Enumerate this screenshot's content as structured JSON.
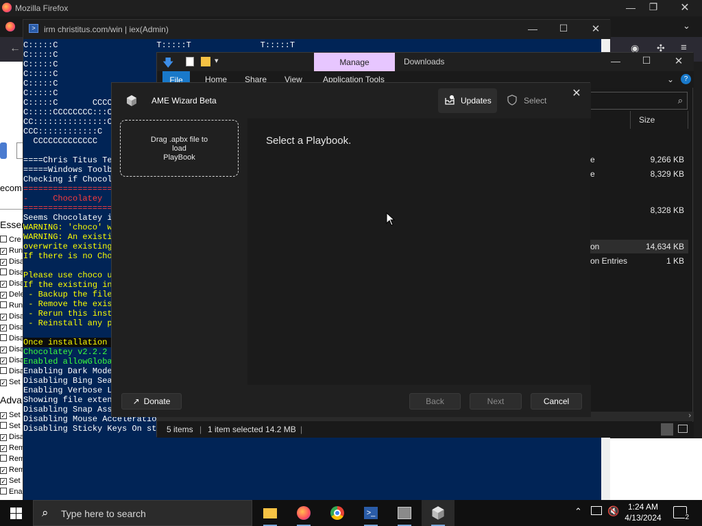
{
  "firefox": {
    "title": "Mozilla Firefox",
    "left_text": "ecom",
    "sections": [
      "Essen",
      "Adva"
    ],
    "checkbox_labels": [
      "Cre",
      "Run",
      "Disa",
      "Disa",
      "Disa",
      "Dele",
      "Run",
      "Disa",
      "Disa",
      "Disa",
      "Disa",
      "Disa",
      "Disa",
      "Set",
      "Set",
      "Set",
      "Disa",
      "Rem",
      "Rem",
      "Rem",
      "Set",
      "Ena"
    ]
  },
  "powershell": {
    "title": "irm christitus.com/win | iex(Admin)",
    "lines": [
      {
        "text": "C:::::C                    T:::::T              T:::::T",
        "color": "white"
      },
      {
        "text": "C:::::C",
        "color": "white"
      },
      {
        "text": "C:::::C",
        "color": "white"
      },
      {
        "text": "C:::::C",
        "color": "white"
      },
      {
        "text": "C:::::C",
        "color": "white"
      },
      {
        "text": "C:::::C",
        "color": "white"
      },
      {
        "text": "C:::::C       CCCC",
        "color": "white"
      },
      {
        "text": "C:::::CCCCCCCC:::C",
        "color": "white"
      },
      {
        "text": "CC:::::::::::::::C",
        "color": "white"
      },
      {
        "text": "CCC::::::::::::C",
        "color": "white"
      },
      {
        "text": "  CCCCCCCCCCCCC",
        "color": "white"
      },
      {
        "text": "",
        "color": "white"
      },
      {
        "text": "====Chris Titus Tec",
        "color": "white"
      },
      {
        "text": "=====Windows Toolbo",
        "color": "white"
      },
      {
        "text": "Checking if Chocola",
        "color": "white"
      },
      {
        "text": "===================",
        "color": "red"
      },
      {
        "text": "-     Chocolatey",
        "color": "red"
      },
      {
        "text": "===================",
        "color": "red"
      },
      {
        "text": "Seems Chocolatey is",
        "color": "white"
      },
      {
        "text": "WARNING: 'choco' wa",
        "color": "yellow"
      },
      {
        "text": "WARNING: An existin",
        "color": "yellow"
      },
      {
        "text": "overwrite existing",
        "color": "yellow"
      },
      {
        "text": "If there is no Choc",
        "color": "yellow"
      },
      {
        "text": "",
        "color": "white"
      },
      {
        "text": "Please use choco up",
        "color": "yellow"
      },
      {
        "text": "If the existing ins",
        "color": "yellow"
      },
      {
        "text": " - Backup the files",
        "color": "yellow"
      },
      {
        "text": " - Remove the exist",
        "color": "yellow"
      },
      {
        "text": " - Rerun this insta",
        "color": "yellow"
      },
      {
        "text": " - Reinstall any pa",
        "color": "yellow"
      },
      {
        "text": "",
        "color": "white"
      },
      {
        "text": "Once installation i",
        "color": "err"
      },
      {
        "text": "Chocolatey v2.2.2",
        "color": "green"
      },
      {
        "text": "Enabled allowGlobal",
        "color": "green"
      },
      {
        "text": "Enabling Dark Mode",
        "color": "white"
      },
      {
        "text": "Disabling Bing Sear",
        "color": "white"
      },
      {
        "text": "Enabling Verbose Lo",
        "color": "white"
      },
      {
        "text": "Showing file extens",
        "color": "white"
      },
      {
        "text": "Disabling Snap Assi",
        "color": "white"
      },
      {
        "text": "Disabling Mouse Acceleration",
        "color": "white"
      },
      {
        "text": "Disabling Sticky Keys On sta",
        "color": "white"
      }
    ]
  },
  "explorer": {
    "manage_tab": "Manage",
    "title": "Downloads",
    "ribbon_tabs": [
      "File",
      "Home",
      "Share",
      "View",
      "Application Tools"
    ],
    "size_header": "Size",
    "files": [
      {
        "name": "e",
        "size": "9,266 KB"
      },
      {
        "name": "e",
        "size": "8,329 KB"
      },
      {
        "name": "",
        "size": "8,328 KB"
      },
      {
        "name": "on",
        "size": "14,634 KB"
      },
      {
        "name": "on Entries",
        "size": "1 KB"
      }
    ],
    "status": {
      "items": "5 items",
      "selected": "1 item selected  14.2 MB"
    }
  },
  "ame": {
    "title": "AME Wizard Beta",
    "updates_label": "Updates",
    "select_label": "Select",
    "drop_line1": "Drag .apbx file to",
    "drop_line2": "load",
    "drop_line3": "PlayBook",
    "prompt": "Select a Playbook.",
    "donate": "Donate",
    "back": "Back",
    "next": "Next",
    "cancel": "Cancel"
  },
  "taskbar": {
    "search_placeholder": "Type here to search",
    "time": "1:24 AM",
    "date": "4/13/2024",
    "notifications": "2"
  }
}
